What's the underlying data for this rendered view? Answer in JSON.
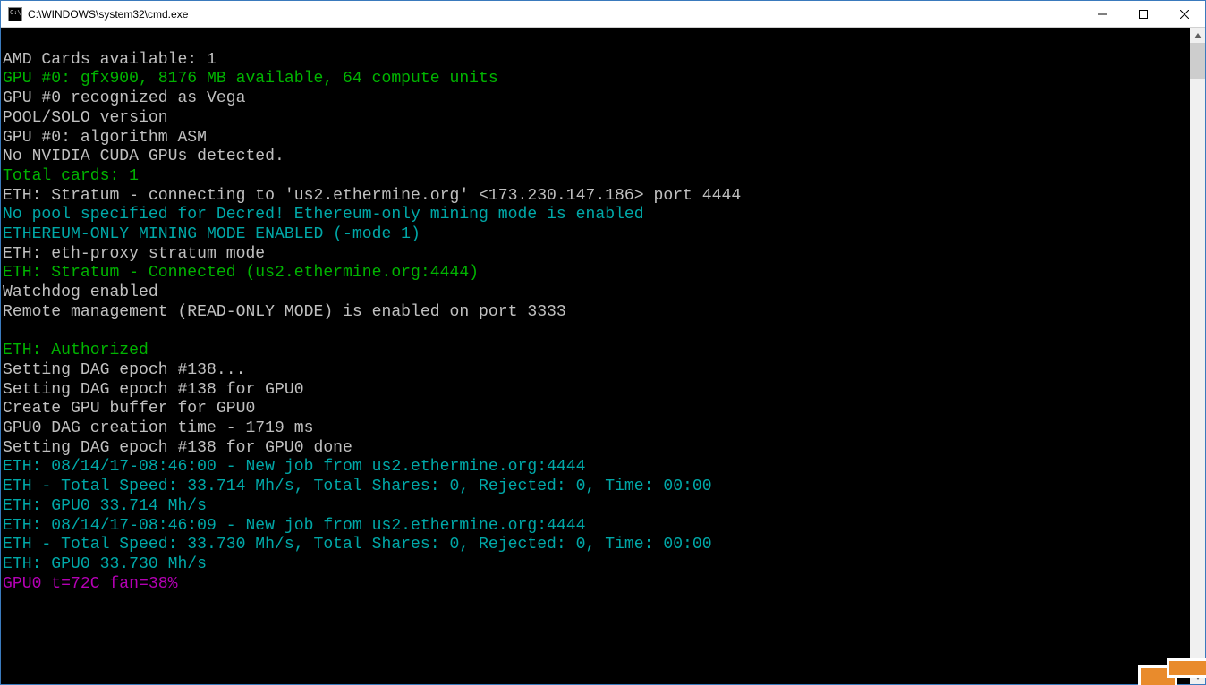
{
  "window": {
    "title": "C:\\WINDOWS\\system32\\cmd.exe"
  },
  "colors": {
    "white": "#c0c0c0",
    "green": "#00b400",
    "cyan": "#00a8a8",
    "magenta": "#b400b4"
  },
  "lines": [
    {
      "color": "white",
      "text": ""
    },
    {
      "color": "white",
      "text": "AMD Cards available: 1"
    },
    {
      "color": "green",
      "text": "GPU #0: gfx900, 8176 MB available, 64 compute units"
    },
    {
      "color": "white",
      "text": "GPU #0 recognized as Vega"
    },
    {
      "color": "white",
      "text": "POOL/SOLO version"
    },
    {
      "color": "white",
      "text": "GPU #0: algorithm ASM"
    },
    {
      "color": "white",
      "text": "No NVIDIA CUDA GPUs detected."
    },
    {
      "color": "green",
      "text": "Total cards: 1"
    },
    {
      "color": "white",
      "text": "ETH: Stratum - connecting to 'us2.ethermine.org' <173.230.147.186> port 4444"
    },
    {
      "color": "cyan",
      "text": "No pool specified for Decred! Ethereum-only mining mode is enabled"
    },
    {
      "color": "cyan",
      "text": "ETHEREUM-ONLY MINING MODE ENABLED (-mode 1)"
    },
    {
      "color": "white",
      "text": "ETH: eth-proxy stratum mode"
    },
    {
      "color": "green",
      "text": "ETH: Stratum - Connected (us2.ethermine.org:4444)"
    },
    {
      "color": "white",
      "text": "Watchdog enabled"
    },
    {
      "color": "white",
      "text": "Remote management (READ-ONLY MODE) is enabled on port 3333"
    },
    {
      "color": "white",
      "text": ""
    },
    {
      "color": "green",
      "text": "ETH: Authorized"
    },
    {
      "color": "white",
      "text": "Setting DAG epoch #138..."
    },
    {
      "color": "white",
      "text": "Setting DAG epoch #138 for GPU0"
    },
    {
      "color": "white",
      "text": "Create GPU buffer for GPU0"
    },
    {
      "color": "white",
      "text": "GPU0 DAG creation time - 1719 ms"
    },
    {
      "color": "white",
      "text": "Setting DAG epoch #138 for GPU0 done"
    },
    {
      "color": "cyan",
      "text": "ETH: 08/14/17-08:46:00 - New job from us2.ethermine.org:4444"
    },
    {
      "color": "cyan",
      "text": "ETH - Total Speed: 33.714 Mh/s, Total Shares: 0, Rejected: 0, Time: 00:00"
    },
    {
      "color": "cyan",
      "text": "ETH: GPU0 33.714 Mh/s"
    },
    {
      "color": "cyan",
      "text": "ETH: 08/14/17-08:46:09 - New job from us2.ethermine.org:4444"
    },
    {
      "color": "cyan",
      "text": "ETH - Total Speed: 33.730 Mh/s, Total Shares: 0, Rejected: 0, Time: 00:00"
    },
    {
      "color": "cyan",
      "text": "ETH: GPU0 33.730 Mh/s"
    },
    {
      "color": "magenta",
      "text": "GPU0 t=72C fan=38%"
    }
  ]
}
